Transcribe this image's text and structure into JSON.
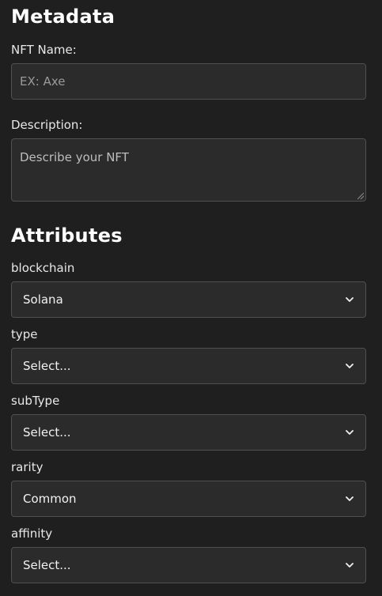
{
  "metadata": {
    "heading": "Metadata",
    "nft_name": {
      "label": "NFT Name:",
      "placeholder": "EX: Axe"
    },
    "description": {
      "label": "Description:",
      "placeholder": "Describe your NFT"
    }
  },
  "attributes": {
    "heading": "Attributes",
    "fields": [
      {
        "label": "blockchain",
        "value": "Solana"
      },
      {
        "label": "type",
        "value": "Select..."
      },
      {
        "label": "subType",
        "value": "Select..."
      },
      {
        "label": "rarity",
        "value": "Common"
      },
      {
        "label": "affinity",
        "value": "Select..."
      }
    ]
  },
  "icons": {
    "select_arrow": "chevron-down-icon"
  },
  "colors": {
    "background": "#1f1f1f",
    "field_background": "#2b2b2b",
    "field_border": "#505050",
    "text": "#e6e6e6",
    "placeholder": "#9a9a9a"
  }
}
